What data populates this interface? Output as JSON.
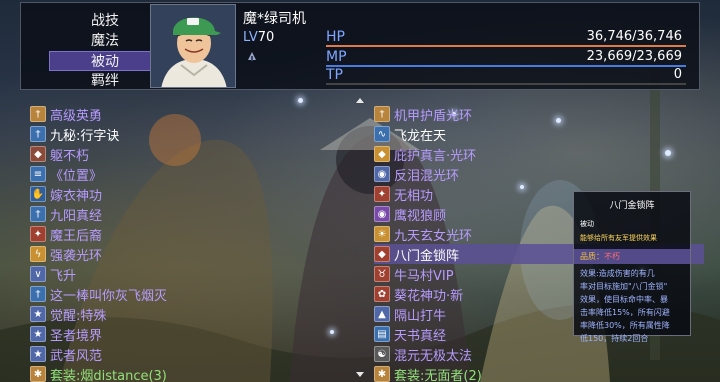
{
  "menu": {
    "items": [
      "战技",
      "魔法",
      "被动",
      "羁绊"
    ],
    "selected_index": 2
  },
  "character": {
    "name": "魔*绿司机",
    "level_prefix": "LV",
    "level": "70",
    "hp_label": "HP",
    "hp_value": "36,746/36,746",
    "hp_ratio": 1.0,
    "mp_label": "MP",
    "mp_value": "23,669/23,669",
    "mp_ratio": 1.0,
    "tp_label": "TP",
    "tp_value": "0",
    "tp_ratio": 0.0
  },
  "colors": {
    "hp_bar": "#e07a4a",
    "mp_bar": "#4a7ce0",
    "tp_bar": "#6a6a6a",
    "skill_name": "#b79bff",
    "set_bonus": "#93e07b",
    "selection": "#4b3f8c"
  },
  "left_skills": [
    {
      "icon": "sword-icon",
      "label": "高级英勇",
      "tone": "p",
      "color": "#b8833a"
    },
    {
      "icon": "sword-icon",
      "label": "九秘:行字诀",
      "tone": "w",
      "color": "#3c6fae"
    },
    {
      "icon": "shield-icon",
      "label": "躯不朽",
      "tone": "p",
      "color": "#8a4b3b"
    },
    {
      "icon": "scroll-icon",
      "label": "《位置》",
      "tone": "p",
      "color": "#3c6fae"
    },
    {
      "icon": "hand-icon",
      "label": "嫁衣神功",
      "tone": "p",
      "color": "#2f5e9a"
    },
    {
      "icon": "sword-icon",
      "label": "九阳真经",
      "tone": "p",
      "color": "#3c6fae"
    },
    {
      "icon": "fire-icon",
      "label": "魔王后裔",
      "tone": "p",
      "color": "#a04030"
    },
    {
      "icon": "bolt-icon",
      "label": "强袭光环",
      "tone": "p",
      "color": "#c89030"
    },
    {
      "icon": "wing-icon",
      "label": "飞升",
      "tone": "p",
      "color": "#5068a8"
    },
    {
      "icon": "sword-icon",
      "label": "这一棒叫你灰飞烟灭",
      "tone": "p",
      "color": "#3c6fae"
    },
    {
      "icon": "star-icon",
      "label": "觉醒:特殊",
      "tone": "p",
      "color": "#5068a8"
    },
    {
      "icon": "star-icon",
      "label": "圣者境界",
      "tone": "p",
      "color": "#5068a8"
    },
    {
      "icon": "star-icon",
      "label": "武者风范",
      "tone": "p",
      "color": "#5068a8"
    },
    {
      "icon": "gear-icon",
      "label": "套装:烟distance(3)",
      "tone": "g",
      "color": "#b8833a"
    }
  ],
  "right_skills": [
    {
      "icon": "sword-icon",
      "label": "机甲护盾光环",
      "tone": "p",
      "color": "#b8833a"
    },
    {
      "icon": "dragon-icon",
      "label": "飞龙在天",
      "tone": "w",
      "color": "#3c6fae"
    },
    {
      "icon": "shield-icon",
      "label": "庇护真言·光环",
      "tone": "p",
      "color": "#c89030"
    },
    {
      "icon": "eye-icon",
      "label": "反泪混光环",
      "tone": "p",
      "color": "#5068a8"
    },
    {
      "icon": "fire-icon",
      "label": "无相功",
      "tone": "p",
      "color": "#a04030"
    },
    {
      "icon": "eye-icon",
      "label": "鹰视狼顾",
      "tone": "p",
      "color": "#7a4aa8"
    },
    {
      "icon": "sun-icon",
      "label": "九天玄女光环",
      "tone": "p",
      "color": "#c89030"
    },
    {
      "icon": "shield-icon",
      "label": "八门金锁阵",
      "tone": "w",
      "color": "#a04030"
    },
    {
      "icon": "bull-icon",
      "label": "牛马村VIP",
      "tone": "p",
      "color": "#a04030"
    },
    {
      "icon": "flower-icon",
      "label": "葵花神功·新",
      "tone": "p",
      "color": "#a04030"
    },
    {
      "icon": "mountain-icon",
      "label": "隔山打牛",
      "tone": "p",
      "color": "#5068a8"
    },
    {
      "icon": "book-icon",
      "label": "天书真经",
      "tone": "p",
      "color": "#3c6fae"
    },
    {
      "icon": "taiji-icon",
      "label": "混元无极太法",
      "tone": "p",
      "color": "#5a5a5a"
    },
    {
      "icon": "gear-icon",
      "label": "套装:无面者(2)",
      "tone": "g",
      "color": "#b8833a"
    }
  ],
  "selected_right_index": 7,
  "tooltip": {
    "title": "八门金锁阵",
    "type": "被动",
    "desc": "能够给所有友军提供效果",
    "source_label": "品质：",
    "source_value": "不朽",
    "effect": "效果:造成伤害的有几\n率对目标施加\"八门金锁\"\n效果，使目标命中率、暴\n击率降低15%，所有闪避\n率降低30%，所有属性降\n低150，持续2回合"
  }
}
